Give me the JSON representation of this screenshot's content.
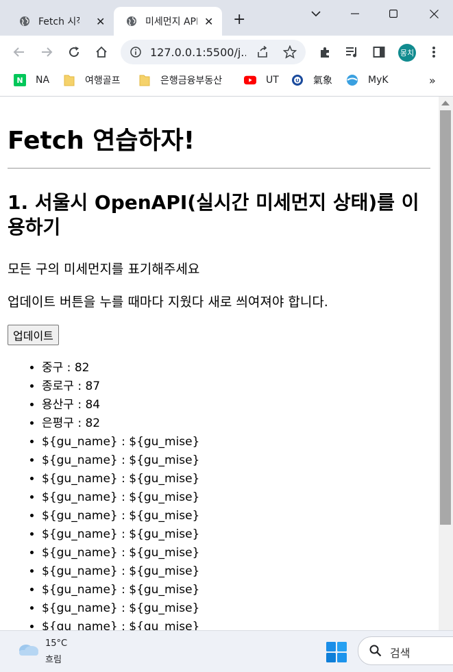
{
  "tabs": [
    {
      "title": "Fetch 시작하기"
    },
    {
      "title": "미세먼지 API"
    }
  ],
  "omnibox": {
    "url": "127.0.0.1:5500/j..."
  },
  "profile": {
    "initials": "몽치"
  },
  "bookmarks": [
    {
      "label": "NA",
      "icon": "naver-icon"
    },
    {
      "label": "여행골프",
      "icon": "folder-icon"
    },
    {
      "label": "은행금융부동산",
      "icon": "folder-icon"
    },
    {
      "label": "UT",
      "icon": "youtube-icon"
    },
    {
      "label": "氣象",
      "icon": "weather-site-icon"
    },
    {
      "label": "MyK",
      "icon": "myk-icon"
    }
  ],
  "bookmarks_more": "»",
  "page": {
    "h1": "Fetch 연습하자!",
    "h2": "1. 서울시 OpenAPI(실시간 미세먼지 상태)를 이용하기",
    "p1": "모든 구의 미세먼지를 표기해주세요",
    "p2": "업데이트 버튼을 누를 때마다 지웠다 새로 씌여져야 합니다.",
    "button": "업데이트",
    "items": [
      "중구 : 82",
      "종로구 : 87",
      "용산구 : 84",
      "은평구 : 82",
      "${gu_name} : ${gu_mise}",
      "${gu_name} : ${gu_mise}",
      "${gu_name} : ${gu_mise}",
      "${gu_name} : ${gu_mise}",
      "${gu_name} : ${gu_mise}",
      "${gu_name} : ${gu_mise}",
      "${gu_name} : ${gu_mise}",
      "${gu_name} : ${gu_mise}",
      "${gu_name} : ${gu_mise}",
      "${gu_name} : ${gu_mise}",
      "${gu_name} : ${gu_mise}"
    ]
  },
  "taskbar": {
    "temperature": "15°C",
    "condition": "흐림",
    "search_label": "검색"
  },
  "colors": {
    "tab_strip": "#dfe3eb",
    "avatar": "#118b8f",
    "scroll_thumb": "#a8a8a8"
  }
}
